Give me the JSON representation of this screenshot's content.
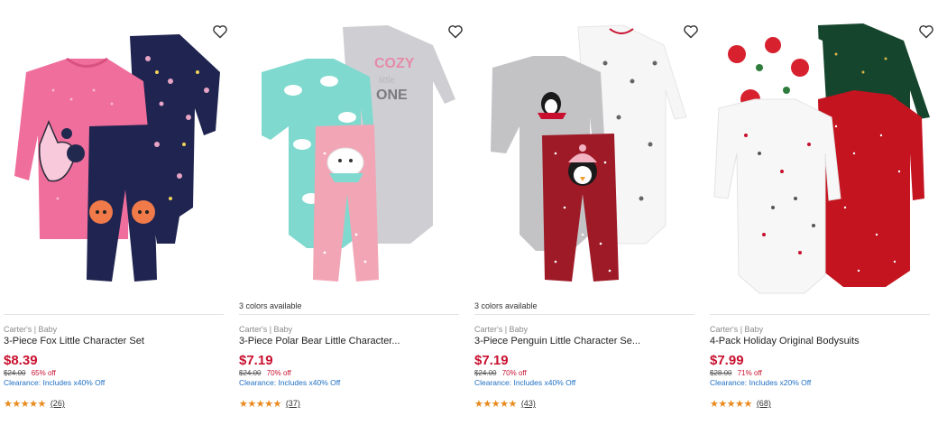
{
  "products": [
    {
      "brand": "Carter's | Baby",
      "name": "3-Piece Fox Little Character Set",
      "price": "$8.39",
      "original_price": "$24.00",
      "discount": "65% off",
      "clearance": "Clearance: Includes x40% Off",
      "stars": "★★★★★",
      "review_count": "(26)",
      "colors_available": "",
      "favorite_icon": "heart-outline-icon"
    },
    {
      "brand": "Carter's | Baby",
      "name": "3-Piece Polar Bear Little Character...",
      "price": "$7.19",
      "original_price": "$24.00",
      "discount": "70% off",
      "clearance": "Clearance: Includes x40% Off",
      "stars": "★★★★★",
      "review_count": "(37)",
      "colors_available": "3 colors available",
      "favorite_icon": "heart-outline-icon"
    },
    {
      "brand": "Carter's | Baby",
      "name": "3-Piece Penguin Little Character Se...",
      "price": "$7.19",
      "original_price": "$24.00",
      "discount": "70% off",
      "clearance": "Clearance: Includes x40% Off",
      "stars": "★★★★★",
      "review_count": "(43)",
      "colors_available": "3 colors available",
      "favorite_icon": "heart-outline-icon"
    },
    {
      "brand": "Carter's | Baby",
      "name": "4-Pack Holiday Original Bodysuits",
      "price": "$7.99",
      "original_price": "$28.00",
      "discount": "71% off",
      "clearance": "Clearance: Includes x20% Off",
      "stars": "★★★★★",
      "review_count": "(68)",
      "colors_available": "",
      "favorite_icon": "heart-outline-icon"
    }
  ],
  "colors": {
    "sale_price": "#c8102e",
    "clearance_link": "#1e6fc4",
    "star": "#e8891b"
  }
}
